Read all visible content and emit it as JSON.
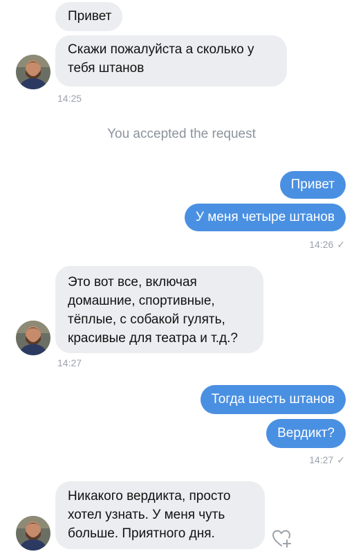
{
  "colors": {
    "incoming_bubble": "#ebedf0",
    "outgoing_bubble": "#4a90e2",
    "timestamp": "#9ba2ab",
    "system_text": "#8b939c"
  },
  "messages": {
    "m1": "Привет",
    "m2_l1": "Скажи пожалуйста а сколько у",
    "m2_l2": "тебя штанов",
    "t1": "14:25",
    "system": "You accepted the request",
    "m3": "Привет",
    "m4": "У меня четыре штанов",
    "t2": "14:26",
    "m5_l1": "Это вот все, включая",
    "m5_l2": "домашние, спортивные,",
    "m5_l3": "тёплые, с собакой гулять,",
    "m5_l4": "красивые для театра и т.д.?",
    "t3": "14:27",
    "m6": "Тогда шесть штанов",
    "m7": "Вердикт?",
    "t4": "14:27",
    "m8_l1": "Никакого вердикта, просто",
    "m8_l2": "хотел узнать. У меня чуть",
    "m8_l3": "больше. Приятного дня."
  },
  "read_check": "✓",
  "icons": {
    "avatar": "contact-avatar",
    "reaction": "heart-plus-icon"
  }
}
